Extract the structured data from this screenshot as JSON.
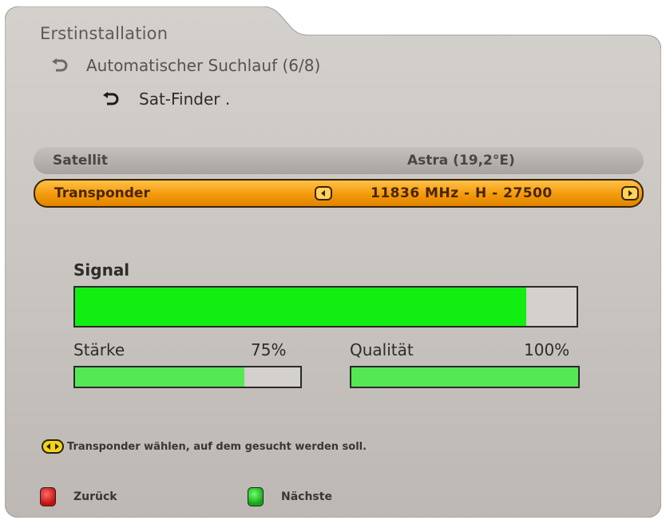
{
  "window": {
    "title": "Erstinstallation"
  },
  "breadcrumb": {
    "step": "Automatischer Suchlauf (6/8)",
    "page": "Sat-Finder ."
  },
  "settings": {
    "satellite": {
      "label": "Satellit",
      "value": "Astra (19,2°E)"
    },
    "transponder": {
      "label": "Transponder",
      "value": "11836 MHz - H - 27500"
    }
  },
  "signal": {
    "label": "Signal",
    "level": 0.9,
    "strength": {
      "label": "Stärke",
      "value_text": "75%",
      "level": 0.75
    },
    "quality": {
      "label": "Qualität",
      "value_text": "100%",
      "level": 1.0
    }
  },
  "help": {
    "text": "Transponder wählen, auf dem gesucht werden soll."
  },
  "keys": {
    "red": {
      "label": "Zurück",
      "color": "#c20f0f"
    },
    "green": {
      "label": "Nächste",
      "color": "#14a414"
    }
  },
  "colors": {
    "highlight": "#f39a0a",
    "bar_fill": "#12ee12",
    "panel": "#c9c4c0"
  }
}
